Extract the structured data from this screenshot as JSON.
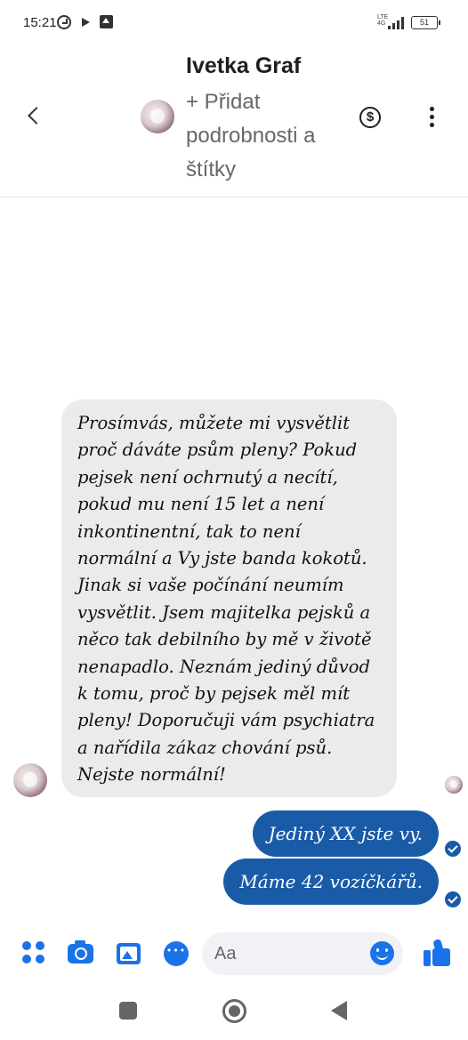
{
  "status_bar": {
    "time": "15:21",
    "network": "LTE",
    "network_sub": "4G",
    "battery": "51"
  },
  "header": {
    "name": "Ivetka Graf",
    "subtitle": "+ Přidat podrobnosti a štítky",
    "icons": [
      "back-arrow-icon",
      "avatar",
      "money-icon",
      "more-options-icon"
    ]
  },
  "messages": {
    "incoming": "Prosímvás, můžete mi vysvětlit proč dáváte psům pleny? Pokud pejsek není ochrnutý a necítí, pokud mu není 15 let a není inkontinentní, tak to není normální a Vy jste banda kokotů. Jinak si vaše počínání neumím vysvětlit. Jsem majitelka pejsků a něco tak debilního by mě v životě nenapadlo. Neznám jediný důvod k tomu, proč by pejsek měl mít pleny! Doporučuji vám psychiatra a nařídila zákaz chování psů. Nejste normální!",
    "outgoing_1": "Jediný XX jste vy.",
    "outgoing_2": "Máme 42 vozíčkářů."
  },
  "composer": {
    "placeholder": "Aa",
    "icons": [
      "apps-icon",
      "camera-icon",
      "gallery-icon",
      "chat-icon",
      "emoji-icon",
      "like-icon"
    ]
  },
  "colors": {
    "accent": "#1a73e8",
    "outgoing_bubble": "#1a5ba7",
    "incoming_bubble": "#ebebeb"
  }
}
